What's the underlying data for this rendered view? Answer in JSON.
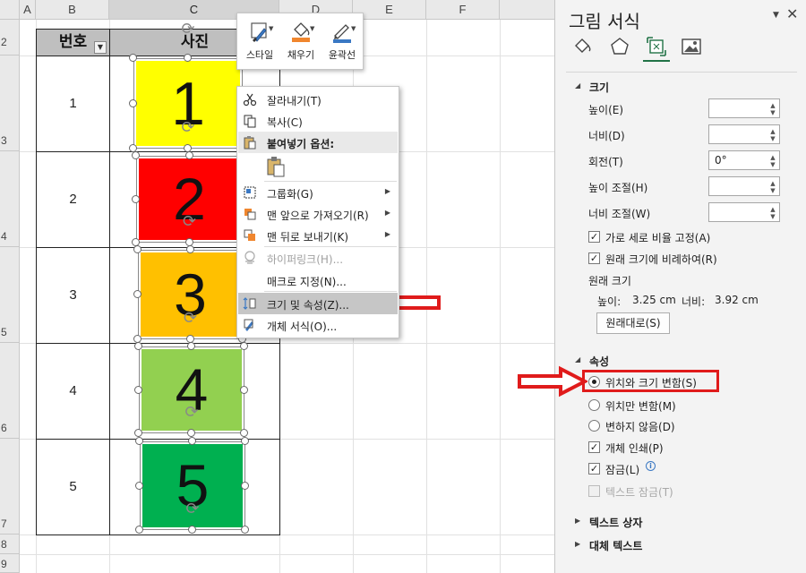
{
  "columns": [
    "A",
    "B",
    "C",
    "D",
    "E",
    "F"
  ],
  "rows": [
    "2",
    "3",
    "4",
    "5",
    "6",
    "7",
    "8",
    "9"
  ],
  "table": {
    "header_number": "번호",
    "header_photo": "사진",
    "numbers": [
      "1",
      "2",
      "3",
      "4",
      "5"
    ]
  },
  "pictures": [
    {
      "label": "1",
      "color": "#ffff00"
    },
    {
      "label": "2",
      "color": "#ff0000"
    },
    {
      "label": "3",
      "color": "#ffc000"
    },
    {
      "label": "4",
      "color": "#92d050"
    },
    {
      "label": "5",
      "color": "#00b050"
    }
  ],
  "mini_toolbar": {
    "style": "스타일",
    "fill": "채우기",
    "outline": "윤곽선"
  },
  "context_menu": {
    "cut": "잘라내기(T)",
    "copy": "복사(C)",
    "paste_options": "붙여넣기 옵션:",
    "group": "그룹화(G)",
    "bring_front": "맨 앞으로 가져오기(R)",
    "send_back": "맨 뒤로 보내기(K)",
    "hyperlink": "하이퍼링크(H)...",
    "assign_macro": "매크로 지정(N)...",
    "size_properties": "크기 및 속성(Z)...",
    "format_object": "개체 서식(O)..."
  },
  "pane": {
    "title": "그림 서식",
    "size_section": "크기",
    "height_label": "높이(E)",
    "width_label": "너비(D)",
    "rotation_label": "회전(T)",
    "rotation_value": "0°",
    "scale_height_label": "높이 조절(H)",
    "scale_width_label": "너비 조절(W)",
    "lock_aspect": "가로 세로 비율 고정(A)",
    "relative_original": "원래 크기에 비례하여(R)",
    "original_size": "원래 크기",
    "original_height_label": "높이:",
    "original_height_value": "3.25 cm",
    "original_width_label": "너비:",
    "original_width_value": "3.92 cm",
    "reset_button": "원래대로(S)",
    "properties_section": "속성",
    "radio_move_size": "위치와 크기 변함(S)",
    "radio_move_only": "위치만 변함(M)",
    "radio_dont_move": "변하지 않음(D)",
    "print_object": "개체 인쇄(P)",
    "locked": "잠금(L)",
    "lock_text": "텍스트 잠금(T)",
    "textbox_section": "텍스트 상자",
    "alt_text_section": "대체 텍스트"
  },
  "colors": {
    "annotation_red": "#e01b1b",
    "accent_orange": "#f0862e",
    "accent_blue": "#3a78c3",
    "pane_green": "#217346"
  }
}
